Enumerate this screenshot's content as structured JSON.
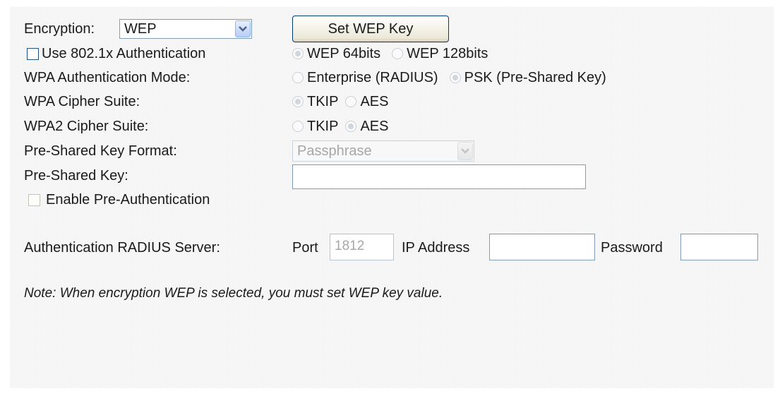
{
  "encryption": {
    "label": "Encryption:",
    "selected": "WEP",
    "set_key_button": "Set WEP Key"
  },
  "use_8021x": {
    "label": "Use 802.1x Authentication",
    "checked": false,
    "options": [
      {
        "label": "WEP 64bits",
        "checked": true
      },
      {
        "label": "WEP 128bits",
        "checked": false
      }
    ]
  },
  "wpa_auth_mode": {
    "label": "WPA Authentication Mode:",
    "options": [
      {
        "label": "Enterprise (RADIUS)",
        "checked": false
      },
      {
        "label": "PSK (Pre-Shared Key)",
        "checked": true
      }
    ]
  },
  "wpa_cipher": {
    "label": "WPA Cipher Suite:",
    "options": [
      {
        "label": "TKIP",
        "checked": true
      },
      {
        "label": "AES",
        "checked": false
      }
    ]
  },
  "wpa2_cipher": {
    "label": "WPA2 Cipher Suite:",
    "options": [
      {
        "label": "TKIP",
        "checked": false
      },
      {
        "label": "AES",
        "checked": true
      }
    ]
  },
  "psk_format": {
    "label": "Pre-Shared Key Format:",
    "selected": "Passphrase"
  },
  "psk": {
    "label": "Pre-Shared Key:",
    "value": ""
  },
  "pre_auth": {
    "label": "Enable Pre-Authentication",
    "checked": false
  },
  "radius": {
    "label": "Authentication RADIUS Server:",
    "port_label": "Port",
    "port_value": "1812",
    "ip_label": "IP Address",
    "ip_value": "",
    "password_label": "Password",
    "password_value": ""
  },
  "note": "Note: When encryption WEP is selected, you must set WEP key value."
}
